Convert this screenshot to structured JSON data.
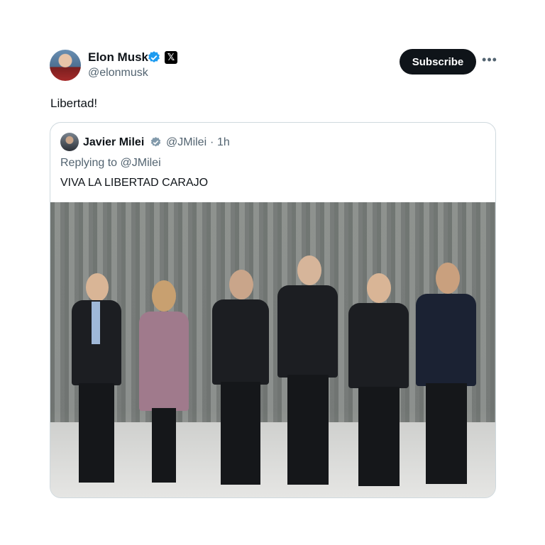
{
  "post": {
    "author_name": "Elon Musk",
    "author_handle": "@elonmusk",
    "subscribe_label": "Subscribe",
    "more_label": "•••",
    "text": "Libertad!",
    "x_logo": "𝕏"
  },
  "quoted": {
    "author_name": "Javier Milei",
    "author_handle": "@JMilei",
    "separator": "·",
    "time": "1h",
    "replying_to": "Replying to @JMilei",
    "text": "VIVA LA LIBERTAD CARAJO"
  },
  "icons": {
    "verified": "verified-badge-icon",
    "verified_gray": "verified-gray-badge-icon",
    "more": "more-icon",
    "x_logo": "x-logo-icon"
  },
  "colors": {
    "verified_blue": "#1d9bf0",
    "verified_gray": "#829aab",
    "subscribe_bg": "#0f1419",
    "secondary_text": "#536471"
  }
}
